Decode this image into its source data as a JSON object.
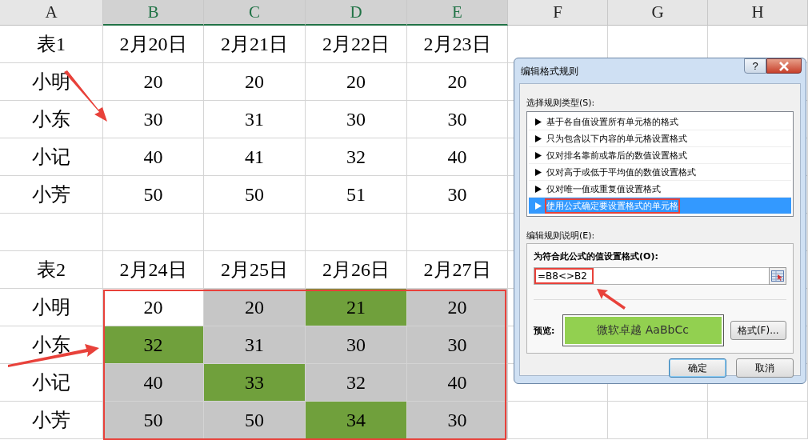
{
  "columns": [
    {
      "label": "A",
      "selected": false
    },
    {
      "label": "B",
      "selected": true
    },
    {
      "label": "C",
      "selected": true
    },
    {
      "label": "D",
      "selected": true
    },
    {
      "label": "E",
      "selected": true
    },
    {
      "label": "F",
      "selected": false
    },
    {
      "label": "G",
      "selected": false
    },
    {
      "label": "H",
      "selected": false
    }
  ],
  "rows": [
    {
      "kind": "data",
      "cells": [
        {
          "text": "表1"
        },
        {
          "text": "2月20日"
        },
        {
          "text": "2月21日"
        },
        {
          "text": "2月22日"
        },
        {
          "text": "2月23日"
        }
      ]
    },
    {
      "kind": "data",
      "cells": [
        {
          "text": "小明"
        },
        {
          "text": "20"
        },
        {
          "text": "20"
        },
        {
          "text": "20"
        },
        {
          "text": "20"
        }
      ]
    },
    {
      "kind": "data",
      "cells": [
        {
          "text": "小东"
        },
        {
          "text": "30"
        },
        {
          "text": "31"
        },
        {
          "text": "30"
        },
        {
          "text": "30"
        }
      ]
    },
    {
      "kind": "data",
      "cells": [
        {
          "text": "小记"
        },
        {
          "text": "40"
        },
        {
          "text": "41"
        },
        {
          "text": "32"
        },
        {
          "text": "40"
        }
      ]
    },
    {
      "kind": "data",
      "cells": [
        {
          "text": "小芳"
        },
        {
          "text": "50"
        },
        {
          "text": "50"
        },
        {
          "text": "51"
        },
        {
          "text": "30"
        }
      ]
    },
    {
      "kind": "blank"
    },
    {
      "kind": "data",
      "cells": [
        {
          "text": "表2"
        },
        {
          "text": "2月24日"
        },
        {
          "text": "2月25日"
        },
        {
          "text": "2月26日"
        },
        {
          "text": "2月27日"
        }
      ]
    },
    {
      "kind": "data",
      "cells": [
        {
          "text": "小明"
        },
        {
          "text": "20",
          "active": true,
          "formatted": false
        },
        {
          "text": "20",
          "active": false,
          "formatted": false
        },
        {
          "text": "21",
          "active": false,
          "formatted": true
        },
        {
          "text": "20",
          "active": false,
          "formatted": false
        }
      ]
    },
    {
      "kind": "data",
      "cells": [
        {
          "text": "小东"
        },
        {
          "text": "32",
          "active": false,
          "formatted": true
        },
        {
          "text": "31",
          "active": false,
          "formatted": false
        },
        {
          "text": "30",
          "active": false,
          "formatted": false
        },
        {
          "text": "30",
          "active": false,
          "formatted": false
        }
      ]
    },
    {
      "kind": "data",
      "cells": [
        {
          "text": "小记"
        },
        {
          "text": "40",
          "active": false,
          "formatted": false
        },
        {
          "text": "33",
          "active": false,
          "formatted": true
        },
        {
          "text": "32",
          "active": false,
          "formatted": false
        },
        {
          "text": "40",
          "active": false,
          "formatted": false
        }
      ]
    },
    {
      "kind": "data",
      "cells": [
        {
          "text": "小芳"
        },
        {
          "text": "50",
          "active": false,
          "formatted": false
        },
        {
          "text": "50",
          "active": false,
          "formatted": false
        },
        {
          "text": "34",
          "active": false,
          "formatted": true
        },
        {
          "text": "30",
          "active": false,
          "formatted": false
        }
      ]
    }
  ],
  "dialog": {
    "title": "编辑格式规则",
    "help": "?",
    "rule_type_label": "选择规则类型(S):",
    "rule_types": [
      {
        "label": "基于各自值设置所有单元格的格式",
        "selected": false
      },
      {
        "label": "只为包含以下内容的单元格设置格式",
        "selected": false
      },
      {
        "label": "仅对排名靠前或靠后的数值设置格式",
        "selected": false
      },
      {
        "label": "仅对高于或低于平均值的数值设置格式",
        "selected": false
      },
      {
        "label": "仅对唯一值或重复值设置格式",
        "selected": false
      },
      {
        "label": "使用公式确定要设置格式的单元格",
        "selected": true
      }
    ],
    "description_label": "编辑规则说明(E):",
    "formula_label": "为符合此公式的值设置格式(O):",
    "formula": "=B8<>B2",
    "preview_label": "预览:",
    "preview_text": "微软卓越  AaBbCc",
    "format_button": "格式(F)...",
    "ok": "确定",
    "cancel": "取消"
  }
}
